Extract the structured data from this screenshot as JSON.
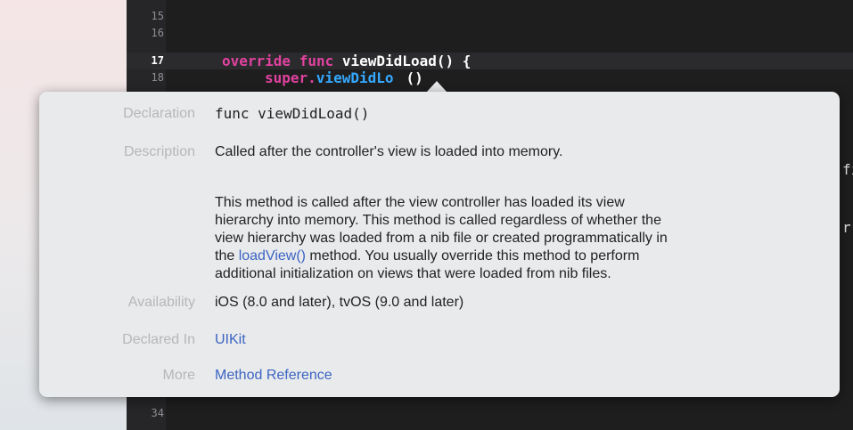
{
  "editor": {
    "lines": [
      {
        "num": "15",
        "code": ""
      },
      {
        "num": "16",
        "code": ""
      },
      {
        "num": "17",
        "keyword": "override func",
        "name": "viewDidLoad",
        "rest": "() {"
      },
      {
        "num": "18",
        "obj": "super.",
        "call": "viewDidLo",
        "tail": "()"
      },
      {
        "num": "34",
        "code": ""
      }
    ],
    "right_chars": [
      "fi",
      "r"
    ]
  },
  "quick_help": {
    "declaration": {
      "label": "Declaration",
      "value": "func viewDidLoad()"
    },
    "description": {
      "label": "Description",
      "summary": "Called after the controller's view is loaded into memory.",
      "details": {
        "l1": "This method is called after the view controller has loaded its view",
        "l2": "hierarchy into memory. This method is called regardless of whether the",
        "l3": "view hierarchy was loaded from a nib file or created programmatically in",
        "l4_pre": "the ",
        "l4_link": "loadView()",
        "l4_post": " method. You usually override this method to perform",
        "l5": "additional initialization on views that were loaded from nib files."
      }
    },
    "availability": {
      "label": "Availability",
      "value": "iOS (8.0 and later), tvOS (9.0 and later)"
    },
    "declared_in": {
      "label": "Declared In",
      "value": "UIKit"
    },
    "more": {
      "label": "More",
      "value": "Method Reference"
    }
  },
  "colors": {
    "keyword": "#e0429e",
    "function": "#35a9ff",
    "link": "#3c64c4"
  }
}
